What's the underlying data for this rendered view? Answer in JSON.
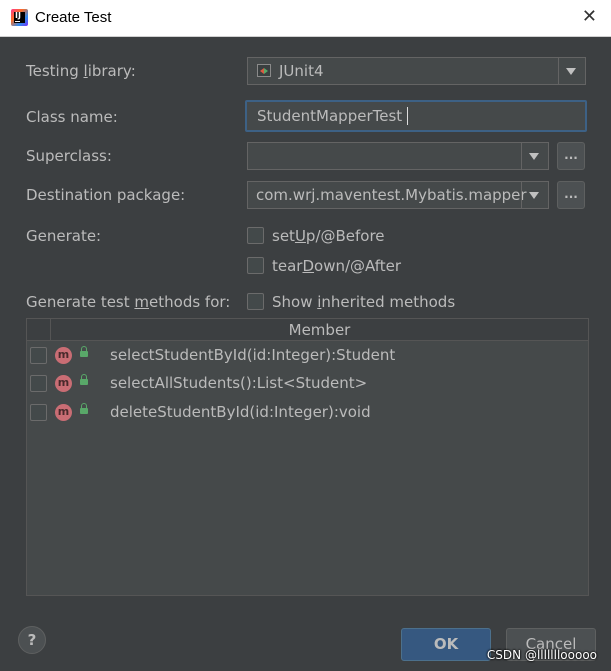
{
  "window": {
    "title": "Create Test",
    "close_glyph": "✕"
  },
  "form": {
    "testing_library": {
      "label_pre": "Testing ",
      "label_u": "l",
      "label_post": "ibrary:",
      "value": "JUnit4"
    },
    "class_name": {
      "label": "Class name:",
      "value": "StudentMapperTest"
    },
    "superclass": {
      "label": "Superclass:",
      "value": "",
      "browse": "..."
    },
    "destination_package": {
      "label": "Destination package:",
      "value": "com.wrj.maventest.Mybatis.mapper",
      "browse": "..."
    },
    "generate": {
      "label": "Generate:",
      "setup": {
        "pre": "set",
        "u": "U",
        "post": "p/@Before",
        "checked": false
      },
      "teardown": {
        "pre": "tear",
        "u": "D",
        "post": "own/@After",
        "checked": false
      }
    },
    "methods_for": {
      "label_pre": "Generate test ",
      "label_u": "m",
      "label_post": "ethods for:"
    },
    "show_inherited": {
      "pre": "Show ",
      "u": "i",
      "post": "nherited methods",
      "checked": false
    }
  },
  "table": {
    "header": "Member",
    "rows": [
      {
        "signature": "selectStudentById(id:Integer):Student",
        "icon": "m",
        "checked": false
      },
      {
        "signature": "selectAllStudents():List<Student>",
        "icon": "m",
        "checked": false
      },
      {
        "signature": "deleteStudentById(id:Integer):void",
        "icon": "m",
        "checked": false
      }
    ]
  },
  "footer": {
    "help": "?",
    "ok": "OK",
    "cancel": "Cancel"
  },
  "watermark": "CSDN @lllllllooooo",
  "colors": {
    "background": "#3c3f41",
    "field": "#45494a",
    "focus_border": "#3d6185",
    "ok_button": "#365880",
    "method_icon": "#c96d74",
    "lock_icon": "#59a869"
  },
  "icons": {
    "app": "intellij-idea-icon",
    "library": "junit-icon",
    "method": "method-icon",
    "visibility": "public-lock-icon"
  }
}
